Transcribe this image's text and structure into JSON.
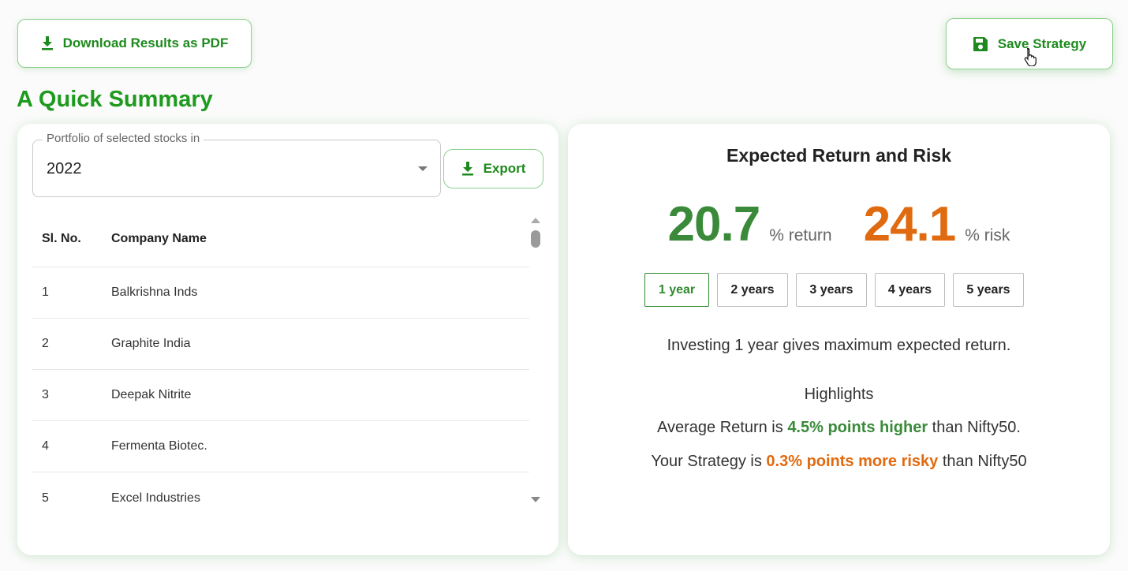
{
  "toolbar": {
    "download_label": "Download Results as PDF",
    "save_label": "Save Strategy"
  },
  "page_title": "A Quick Summary",
  "portfolio": {
    "legend": "Portfolio of selected stocks in",
    "selected_year": "2022",
    "export_label": "Export"
  },
  "table": {
    "headers": [
      "Sl. No.",
      "Company Name"
    ],
    "rows": [
      {
        "no": "1",
        "company": "Balkrishna Inds"
      },
      {
        "no": "2",
        "company": "Graphite India"
      },
      {
        "no": "3",
        "company": "Deepak Nitrite"
      },
      {
        "no": "4",
        "company": "Fermenta Biotec."
      },
      {
        "no": "5",
        "company": "Excel Industries"
      }
    ]
  },
  "return_risk": {
    "title": "Expected Return and Risk",
    "return_value": "20.7",
    "return_unit": "% return",
    "risk_value": "24.1",
    "risk_unit": "% risk",
    "tabs": [
      "1 year",
      "2 years",
      "3 years",
      "4 years",
      "5 years"
    ],
    "active_tab": "1 year",
    "insight": "Investing 1 year gives maximum expected return.",
    "highlights_heading": "Highlights",
    "highlight1": {
      "pre": "Average Return is ",
      "emph": "4.5% points higher",
      "post": " than Nifty50."
    },
    "highlight2": {
      "pre": "Your Strategy is ",
      "emph": "0.3% points more risky",
      "post": " than Nifty50"
    }
  },
  "colors": {
    "accent_green": "#1e9a1e",
    "return_green": "#3a8a3a",
    "risk_orange": "#e06a10"
  },
  "icons": [
    "download-icon",
    "save-icon",
    "dropdown-arrow-icon",
    "pointer-cursor-icon"
  ]
}
